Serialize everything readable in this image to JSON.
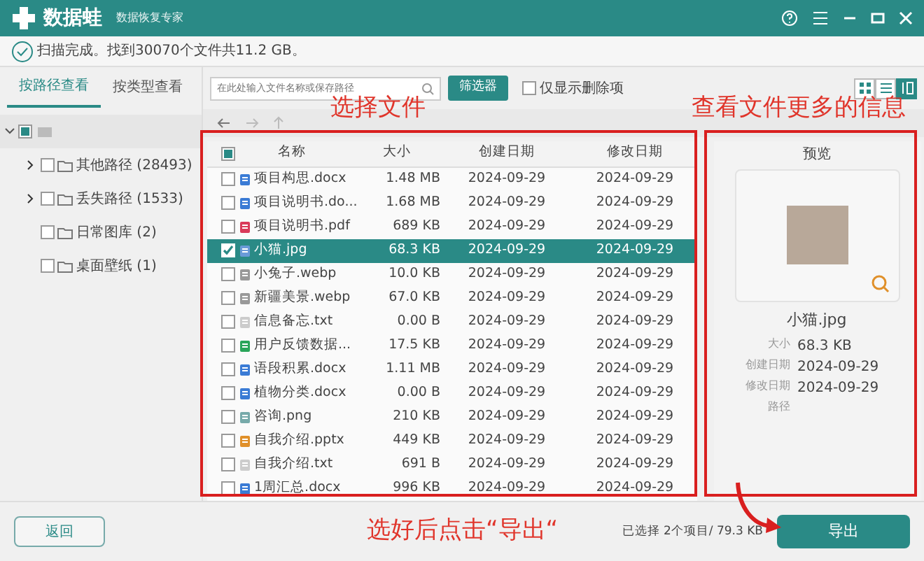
{
  "window": {
    "app_name": "数据蛙",
    "subtitle": "数据恢复专家"
  },
  "scan_status": "扫描完成。找到30070个文件共11.2 GB。",
  "view_tabs": [
    {
      "label": "按路径查看",
      "selected": true
    },
    {
      "label": "按类型查看",
      "selected": false
    }
  ],
  "tree": [
    {
      "checked": false,
      "indeterminate": true,
      "expanded": true,
      "children": [
        {
          "label": "其他路径 (28493)",
          "checked": false,
          "expandable": true
        },
        {
          "label": "丢失路径 (1533)",
          "checked": false,
          "expandable": true
        },
        {
          "label": "日常图库 (2)",
          "checked": false,
          "expandable": false
        },
        {
          "label": "桌面壁纸 (1)",
          "checked": false,
          "expandable": false
        }
      ]
    }
  ],
  "search": {
    "placeholder": "在此处输入文件名称或保存路径"
  },
  "filter_button": "筛选器",
  "deleted_only": {
    "label": "仅显示删除项",
    "checked": false
  },
  "view_modes": [
    {
      "kind": "grid",
      "selected": false
    },
    {
      "kind": "list",
      "selected": false
    },
    {
      "kind": "detail",
      "selected": true
    }
  ],
  "table": {
    "header_checkbox": {
      "checked": false,
      "indeterminate": true
    },
    "columns": [
      "名称",
      "大小",
      "创建日期",
      "修改日期"
    ],
    "rows": [
      {
        "name": "项目构思.docx",
        "kind": "doc",
        "size": "1.48 MB",
        "created": "2024-09-29",
        "modified": "2024-09-29",
        "selected": false
      },
      {
        "name": "项目说明书.do...",
        "kind": "doc",
        "size": "1.68 MB",
        "created": "2024-09-29",
        "modified": "2024-09-29",
        "selected": false
      },
      {
        "name": "项目说明书.pdf",
        "kind": "pdf",
        "size": "689 KB",
        "created": "2024-09-29",
        "modified": "2024-09-29",
        "selected": false
      },
      {
        "name": "小猫.jpg",
        "kind": "img",
        "size": "68.3 KB",
        "created": "2024-09-29",
        "modified": "2024-09-29",
        "selected": true
      },
      {
        "name": "小兔子.webp",
        "kind": "webp",
        "size": "10.0 KB",
        "created": "2024-09-29",
        "modified": "2024-09-29",
        "selected": false
      },
      {
        "name": "新疆美景.webp",
        "kind": "webp",
        "size": "67.0 KB",
        "created": "2024-09-29",
        "modified": "2024-09-29",
        "selected": false
      },
      {
        "name": "信息备忘.txt",
        "kind": "txt",
        "size": "0.00 B",
        "created": "2024-09-29",
        "modified": "2024-09-29",
        "selected": false
      },
      {
        "name": "用户反馈数据...",
        "kind": "xls",
        "size": "17.5 KB",
        "created": "2024-09-29",
        "modified": "2024-09-29",
        "selected": false
      },
      {
        "name": "语段积累.docx",
        "kind": "doc",
        "size": "1.11 MB",
        "created": "2024-09-29",
        "modified": "2024-09-29",
        "selected": false
      },
      {
        "name": "植物分类.docx",
        "kind": "doc",
        "size": "0.00 B",
        "created": "2024-09-29",
        "modified": "2024-09-29",
        "selected": false
      },
      {
        "name": "咨询.png",
        "kind": "png",
        "size": "210 KB",
        "created": "2024-09-29",
        "modified": "2024-09-29",
        "selected": false
      },
      {
        "name": "自我介绍.pptx",
        "kind": "ppt",
        "size": "449 KB",
        "created": "2024-09-29",
        "modified": "2024-09-29",
        "selected": false
      },
      {
        "name": "自我介绍.txt",
        "kind": "txt",
        "size": "691 B",
        "created": "2024-09-29",
        "modified": "2024-09-29",
        "selected": false
      },
      {
        "name": "1周汇总.docx",
        "kind": "doc",
        "size": "996 KB",
        "created": "2024-09-29",
        "modified": "2024-09-29",
        "selected": false
      }
    ]
  },
  "preview": {
    "title": "预览",
    "file_name": "小猫.jpg",
    "details": [
      {
        "label": "大小",
        "value": "68.3 KB"
      },
      {
        "label": "创建日期",
        "value": "2024-09-29"
      },
      {
        "label": "修改日期",
        "value": "2024-09-29"
      },
      {
        "label": "路径"
      }
    ]
  },
  "footer": {
    "back_button": "返回",
    "selection": "已选择 2个项目/ 79.3 KB",
    "export_button": "导出"
  },
  "annotations": [
    {
      "kind": "text",
      "text": "选择文件"
    },
    {
      "kind": "text",
      "text": "查看文件更多的信息"
    },
    {
      "kind": "text",
      "text": "选好后点击“导出“"
    },
    {
      "kind": "frame"
    },
    {
      "kind": "frame"
    },
    {
      "kind": "arrow"
    }
  ]
}
